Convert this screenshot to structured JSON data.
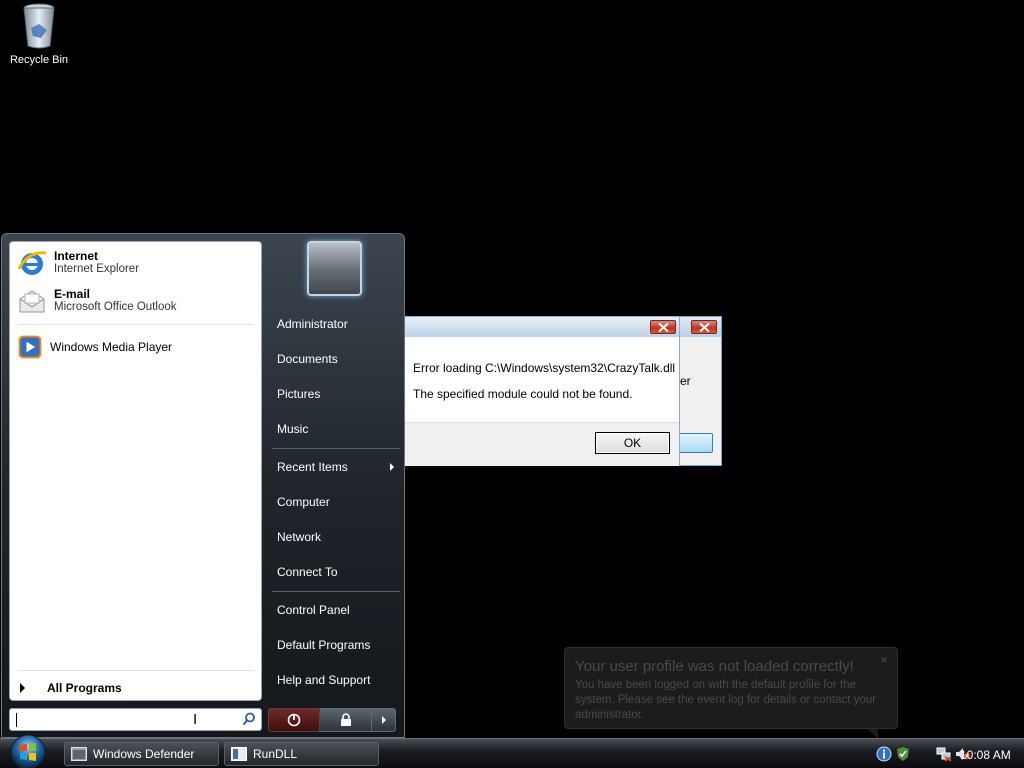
{
  "desktop": {
    "recycle_bin_label": "Recycle Bin"
  },
  "start_menu": {
    "pinned": [
      {
        "title": "Internet",
        "subtitle": "Internet Explorer",
        "icon": "internet-explorer-icon"
      },
      {
        "title": "E-mail",
        "subtitle": "Microsoft Office Outlook",
        "icon": "email-icon"
      }
    ],
    "recent": [
      {
        "title": "Windows Media Player",
        "icon": "media-player-icon"
      }
    ],
    "all_programs_label": "All Programs",
    "search_value": "",
    "right_items": [
      {
        "label": "Administrator"
      },
      {
        "label": "Documents"
      },
      {
        "label": "Pictures"
      },
      {
        "label": "Music"
      },
      {
        "label": "Recent Items",
        "has_submenu": true
      },
      {
        "label": "Computer"
      },
      {
        "label": "Network"
      },
      {
        "label": "Connect To"
      },
      {
        "label": "Control Panel"
      },
      {
        "label": "Default Programs"
      },
      {
        "label": "Help and Support"
      }
    ]
  },
  "dialog_back": {
    "text_fragment": "er"
  },
  "dialog": {
    "message1": "Error loading C:\\Windows\\system32\\CrazyTalk.dll",
    "message2": "The specified module could not be found.",
    "ok_label": "OK"
  },
  "balloon": {
    "title": "Your user profile was not loaded correctly!",
    "body": "You have been logged on with the default profile for the system. Please see the event log for details or contact your administrator.",
    "close": "×"
  },
  "taskbar": {
    "buttons": [
      {
        "label": "Windows Defender"
      },
      {
        "label": "RunDLL"
      }
    ],
    "clock": "10:08 AM"
  },
  "colors": {
    "desktop_bg": "#000000",
    "start_menu_bg": "#1f252b",
    "close_red": "#c0311c"
  }
}
